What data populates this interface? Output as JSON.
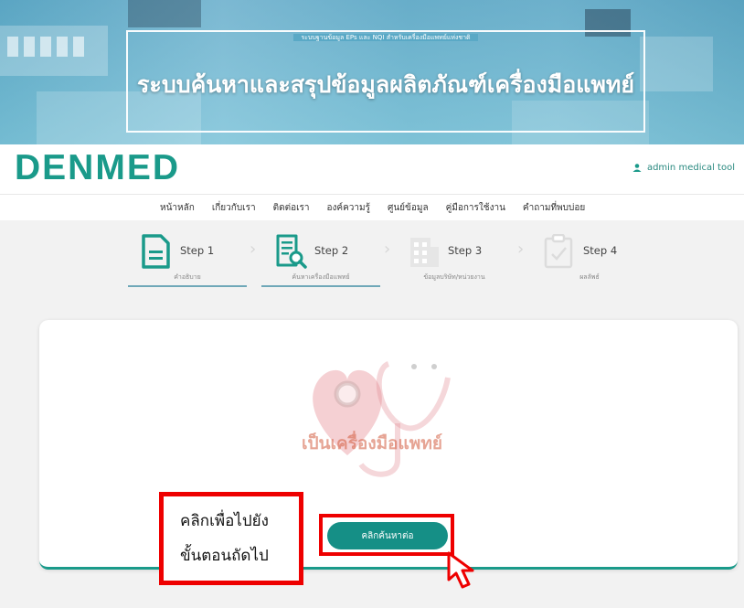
{
  "banner": {
    "subtitle": "ระบบฐานข้อมูล EPs และ NQI สำหรับเครื่องมือแพทย์แห่งชาติ",
    "title": "ระบบค้นหาและสรุปข้อมูลผลิตภัณฑ์เครื่องมือแพทย์"
  },
  "header": {
    "logo": "DENMED",
    "user_icon": "user-icon",
    "user_label": "admin medical tool"
  },
  "nav": {
    "items": [
      {
        "label": "หน้าหลัก"
      },
      {
        "label": "เกี่ยวกับเรา"
      },
      {
        "label": "ติดต่อเรา"
      },
      {
        "label": "องค์ความรู้"
      },
      {
        "label": "ศูนย์ข้อมูล"
      },
      {
        "label": "คู่มือการใช้งาน"
      },
      {
        "label": "คำถามที่พบบ่อย"
      }
    ]
  },
  "steps": [
    {
      "label": "Step 1",
      "caption": "คำอธิบาย",
      "icon": "document-icon",
      "active": true
    },
    {
      "label": "Step 2",
      "caption": "ค้นหาเครื่องมือแพทย์",
      "icon": "document-search-icon",
      "active": true
    },
    {
      "label": "Step 3",
      "caption": "ข้อมูลบริษัท/หน่วยงาน",
      "icon": "building-icon",
      "active": false
    },
    {
      "label": "Step 4",
      "caption": "ผลลัพธ์",
      "icon": "clipboard-check-icon",
      "active": false
    }
  ],
  "card": {
    "illustration": "stethoscope-heart-icon",
    "text": "เป็นเครื่องมือแพทย์",
    "button_label": "คลิกค้นหาต่อ"
  },
  "annotation": {
    "line1": "คลิกเพื่อไปยัง",
    "line2": "ขั้นตอนถัดไป",
    "cursor_icon": "cursor-arrow-icon"
  },
  "colors": {
    "brand": "#1a9a8a",
    "button": "#158f86",
    "highlight": "#ee0000"
  }
}
